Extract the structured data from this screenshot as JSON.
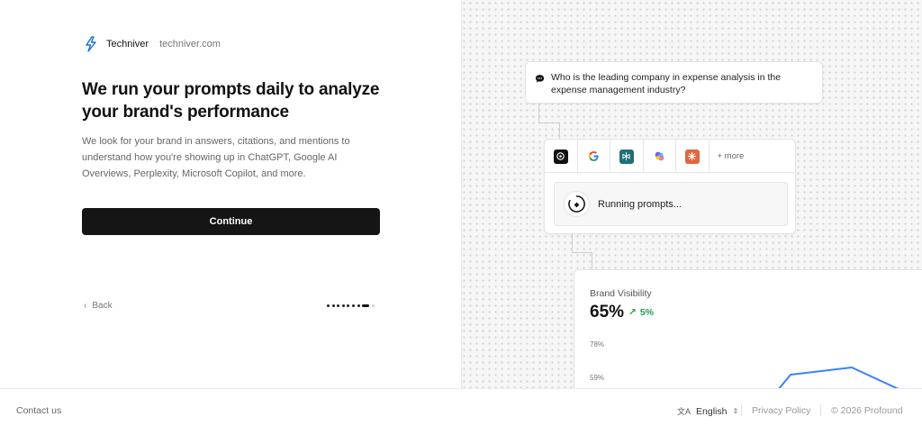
{
  "brand": {
    "name": "Techniver",
    "domain": "techniver.com",
    "logo_icon": "bolt-logo-icon",
    "logo_color": "#1a6fd1"
  },
  "headline": "We run your prompts daily to analyze your brand's performance",
  "description": "We look for your brand in answers, citations, and mentions to understand how you're showing up in ChatGPT, Google AI Overviews, Perplexity, Microsoft Copilot, and more.",
  "continue_label": "Continue",
  "back_label": "Back",
  "steps": {
    "total": 9,
    "current": 8
  },
  "prompt_card": {
    "icon": "chat-bubble-icon",
    "question": "Who is the leading company in expense analysis in the expense management industry?"
  },
  "engines": {
    "items": [
      {
        "name": "chatgpt-icon",
        "color": "#111111"
      },
      {
        "name": "google-icon",
        "color": "#4285f4"
      },
      {
        "name": "perplexity-icon",
        "color": "#1f6f78"
      },
      {
        "name": "copilot-icon",
        "color": "#7b5cf0"
      },
      {
        "name": "claude-icon",
        "color": "#e0673f"
      }
    ],
    "more_label": "+ more",
    "running_label": "Running prompts..."
  },
  "visibility": {
    "title": "Brand Visibility",
    "value": "65%",
    "delta": "5%",
    "delta_color": "#1f9d4c",
    "ticks": [
      "78%",
      "59%"
    ],
    "line_color": "#3b82f6"
  },
  "footer": {
    "contact": "Contact us",
    "language": "English",
    "privacy": "Privacy Policy",
    "copyright": "© 2026 Profound"
  }
}
